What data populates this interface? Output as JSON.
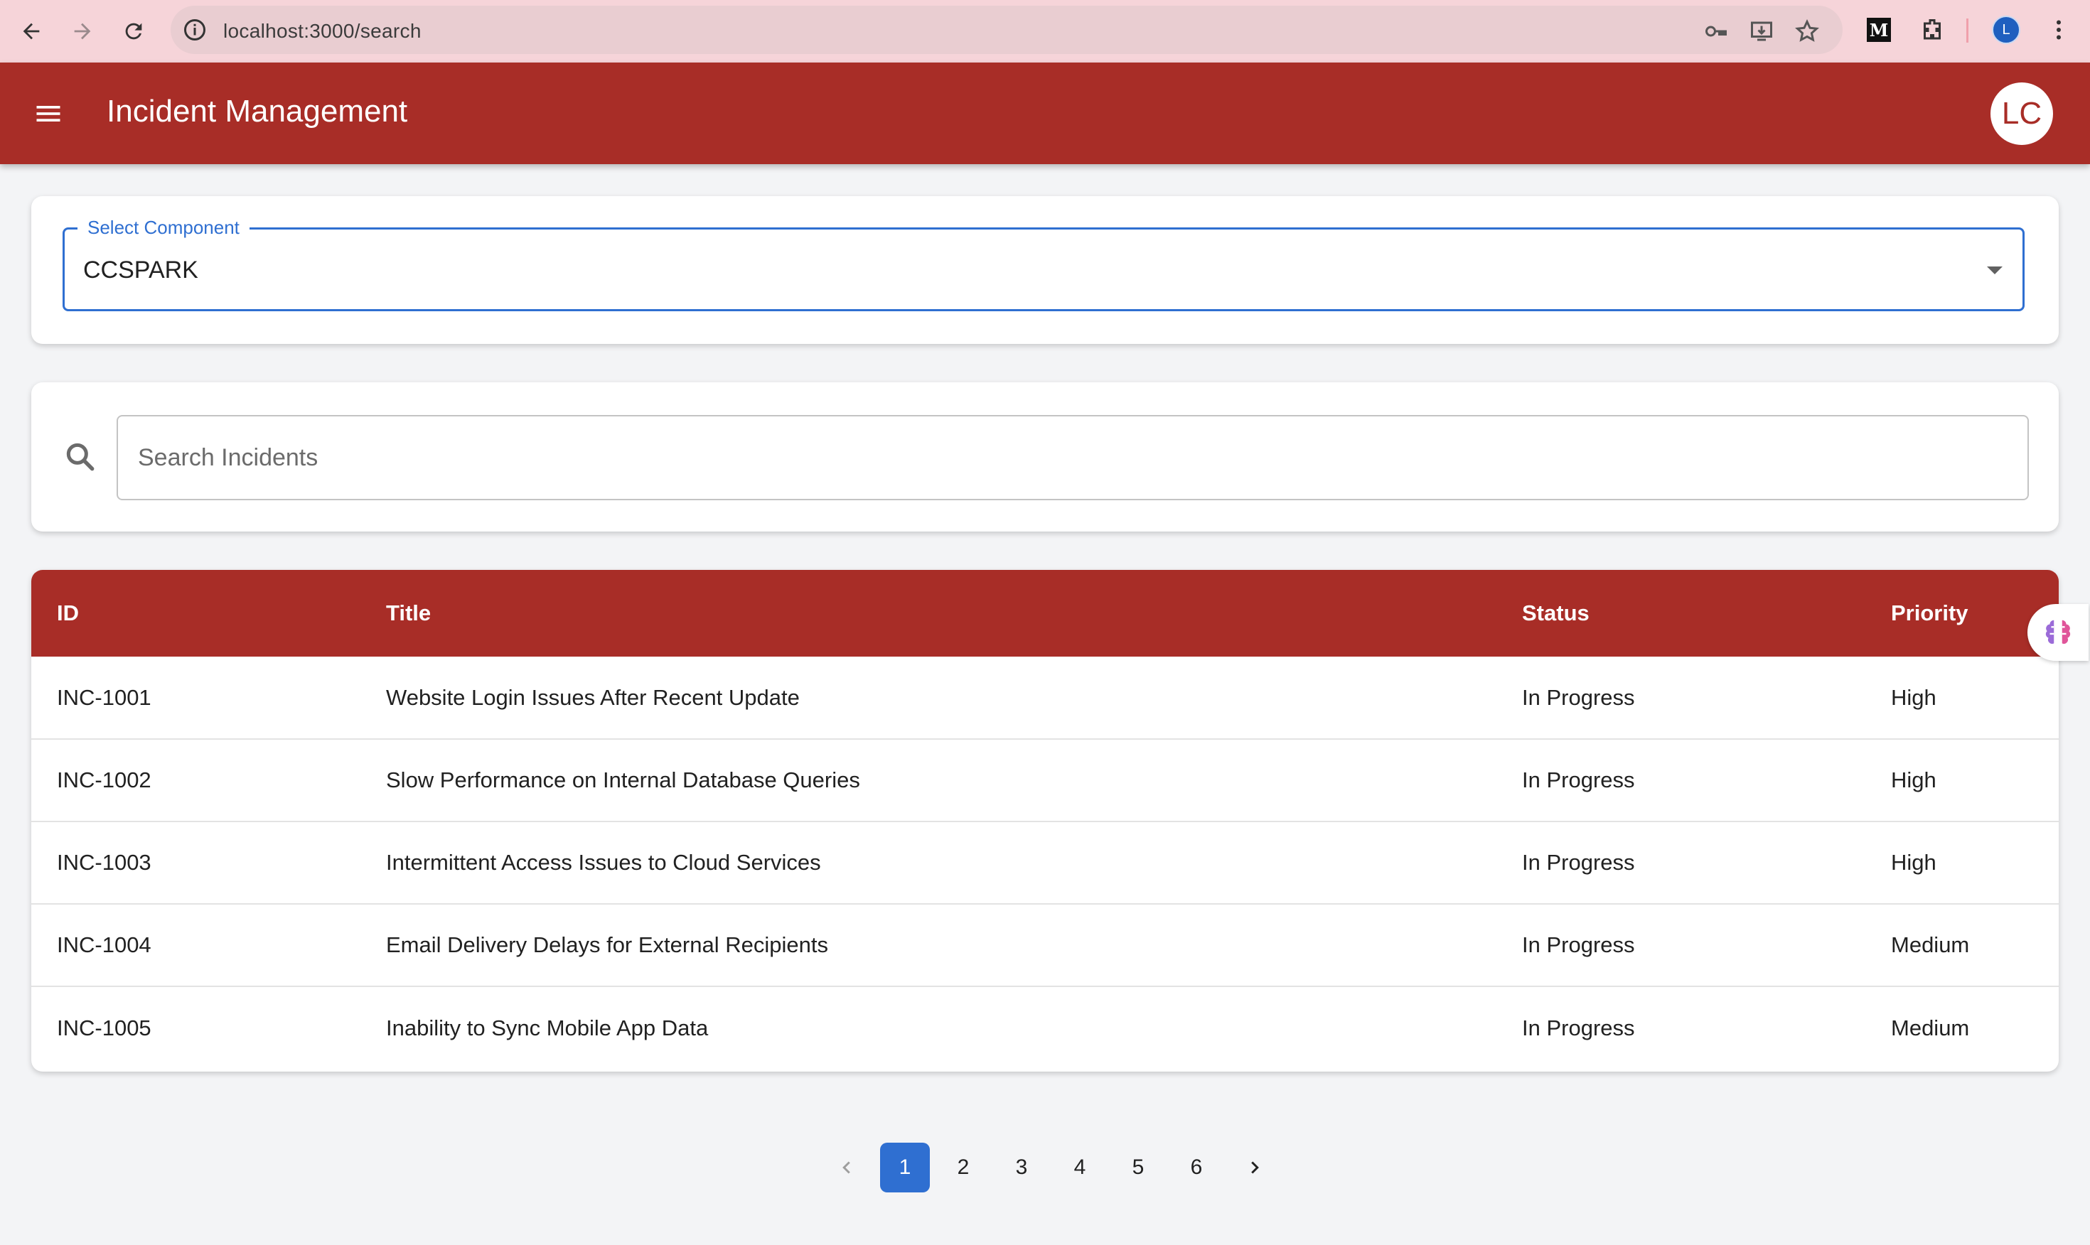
{
  "browser": {
    "url": "localhost:3000/search",
    "profile_initial": "L",
    "extension_letter": "M"
  },
  "app": {
    "title": "Incident Management",
    "avatar_initials": "LC",
    "brand_color": "#a82d27"
  },
  "component_select": {
    "label": "Select Component",
    "value": "CCSPARK"
  },
  "search": {
    "placeholder": "Search Incidents"
  },
  "table": {
    "headers": [
      "ID",
      "Title",
      "Status",
      "Priority"
    ],
    "rows": [
      {
        "id": "INC-1001",
        "title": "Website Login Issues After Recent Update",
        "status": "In Progress",
        "priority": "High"
      },
      {
        "id": "INC-1002",
        "title": "Slow Performance on Internal Database Queries",
        "status": "In Progress",
        "priority": "High"
      },
      {
        "id": "INC-1003",
        "title": "Intermittent Access Issues to Cloud Services",
        "status": "In Progress",
        "priority": "High"
      },
      {
        "id": "INC-1004",
        "title": "Email Delivery Delays for External Recipients",
        "status": "In Progress",
        "priority": "Medium"
      },
      {
        "id": "INC-1005",
        "title": "Inability to Sync Mobile App Data",
        "status": "In Progress",
        "priority": "Medium"
      }
    ]
  },
  "pagination": {
    "pages": [
      "1",
      "2",
      "3",
      "4",
      "5",
      "6"
    ],
    "current": "1"
  }
}
